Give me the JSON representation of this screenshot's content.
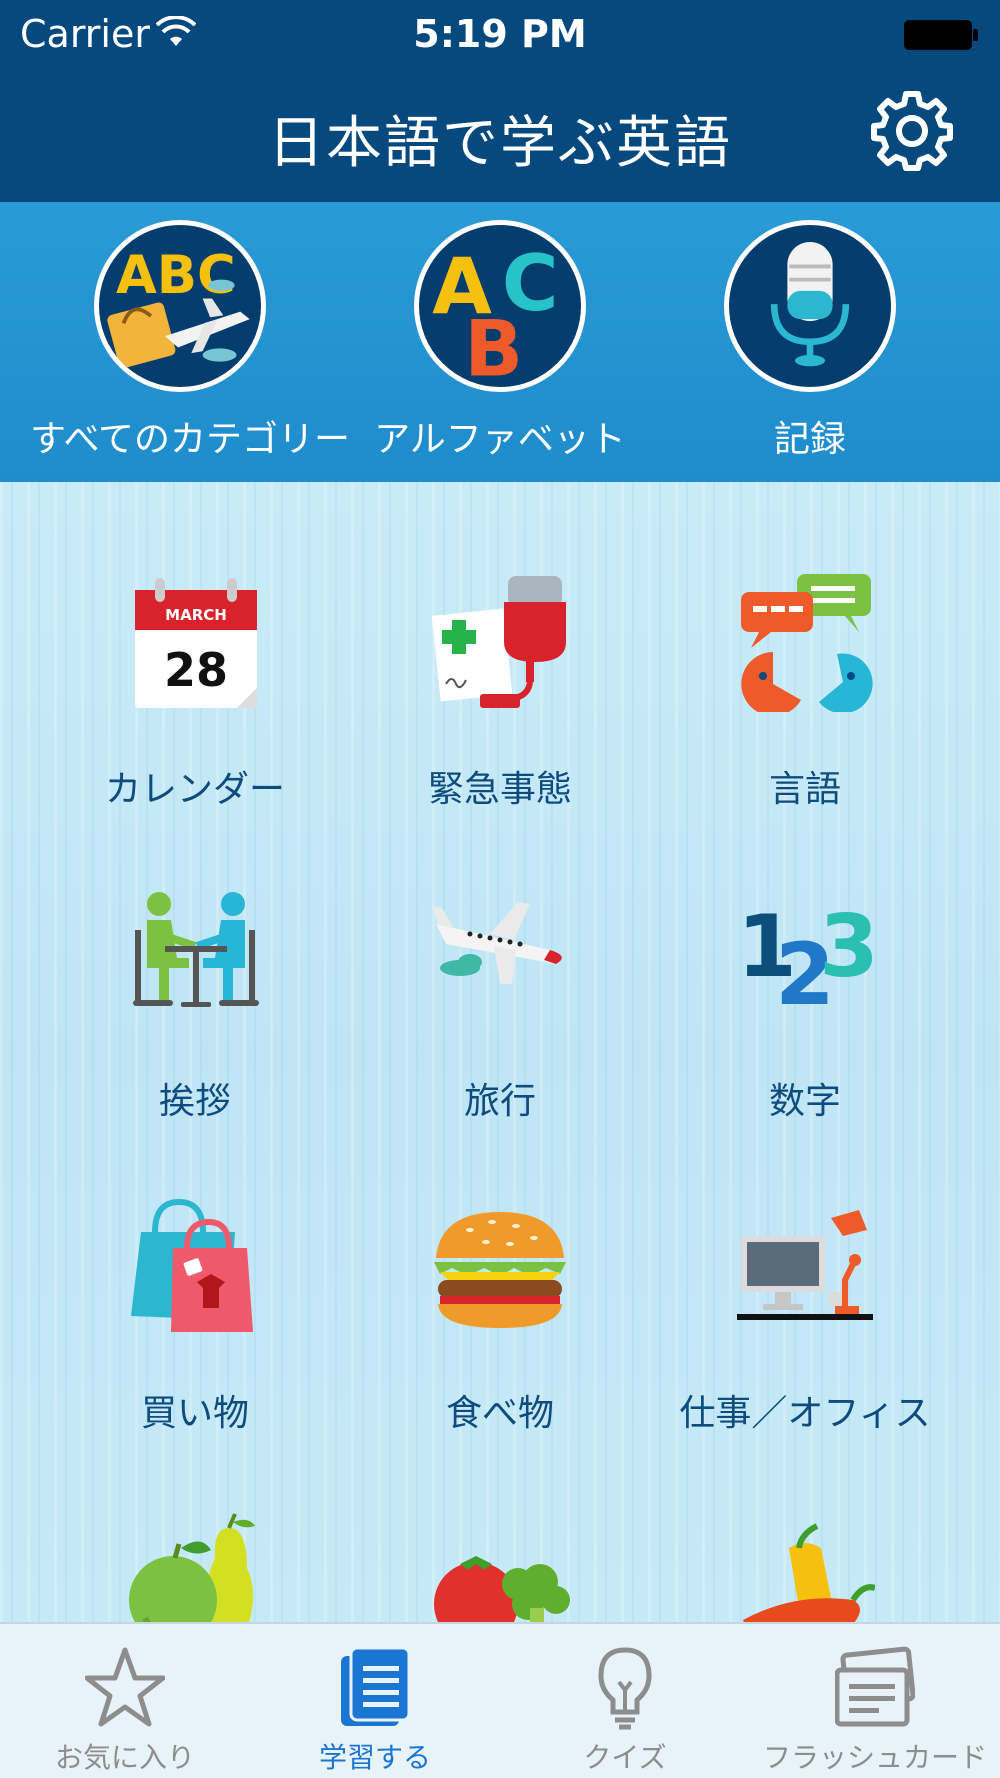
{
  "status_bar": {
    "carrier": "Carrier",
    "time": "5:19 PM"
  },
  "header": {
    "title": "日本語で学ぶ英語",
    "settings_icon": "gear-icon"
  },
  "features": [
    {
      "label": "すべてのカテゴリー",
      "icon": "all-categories-icon",
      "letters": "ABC"
    },
    {
      "label": "アルファベット",
      "icon": "alphabet-icon",
      "letters": "ABC"
    },
    {
      "label": "記録",
      "icon": "microphone-icon"
    }
  ],
  "categories": [
    {
      "label": "カレンダー",
      "icon": "calendar-icon",
      "month": "MARCH",
      "day": "28"
    },
    {
      "label": "緊急事態",
      "icon": "emergency-icon"
    },
    {
      "label": "言語",
      "icon": "speech-bubbles-icon"
    },
    {
      "label": "挨拶",
      "icon": "greeting-icon"
    },
    {
      "label": "旅行",
      "icon": "airplane-icon"
    },
    {
      "label": "数字",
      "icon": "numbers-icon",
      "digits": "123"
    },
    {
      "label": "買い物",
      "icon": "shopping-bags-icon"
    },
    {
      "label": "食べ物",
      "icon": "burger-icon"
    },
    {
      "label": "仕事／オフィス",
      "icon": "office-desk-icon"
    },
    {
      "label": "",
      "icon": "fruits-icon"
    },
    {
      "label": "",
      "icon": "vegetables-icon"
    },
    {
      "label": "",
      "icon": "peppers-icon"
    }
  ],
  "tabs": [
    {
      "label": "お気に入り",
      "icon": "star-icon",
      "active": false
    },
    {
      "label": "学習する",
      "icon": "document-icon",
      "active": true
    },
    {
      "label": "クイズ",
      "icon": "lightbulb-icon",
      "active": false
    },
    {
      "label": "フラッシュカード",
      "icon": "flashcards-icon",
      "active": false
    }
  ],
  "colors": {
    "nav": "#05497f",
    "band": "#2a9bd6",
    "active_tab": "#1a76d2",
    "label": "#0e4c7e"
  }
}
